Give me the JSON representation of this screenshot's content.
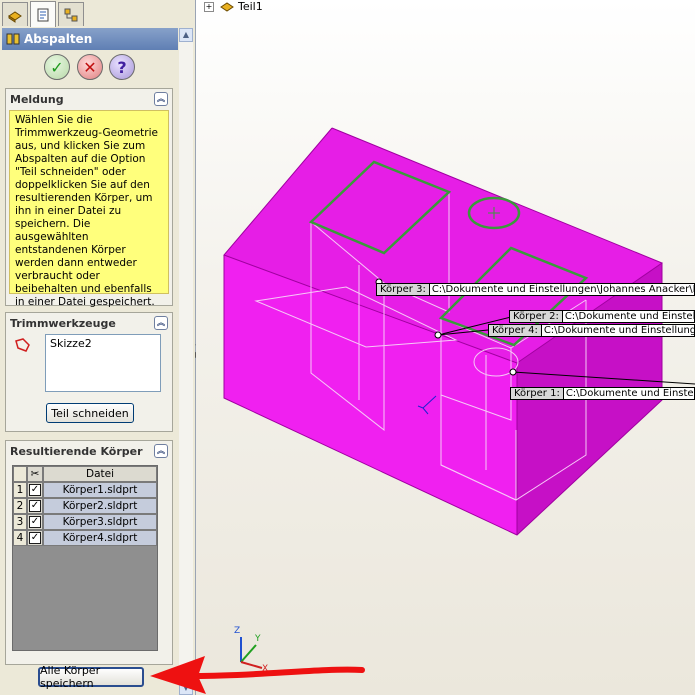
{
  "tree": {
    "root_label": "Teil1",
    "expander": "+"
  },
  "property_manager": {
    "title": "Abspalten",
    "tabs": [
      {
        "icon": "feature-manager-icon"
      },
      {
        "icon": "property-manager-icon"
      },
      {
        "icon": "configuration-manager-icon"
      }
    ],
    "buttons": {
      "ok": "✓",
      "cancel": "✕",
      "help": "?"
    },
    "message": {
      "header": "Meldung",
      "text": "Wählen Sie die Trimmwerkzeug-Geometrie aus, und klicken Sie zum Abspalten auf die Option \"Teil schneiden\" oder doppelklicken Sie auf den resultierenden Körper, um ihn in einer Datei zu speichern. Die ausgewählten entstandenen Körper werden dann entweder verbraucht oder beibehalten und ebenfalls in einer Datei gespeichert."
    },
    "trim_tools": {
      "header": "Trimmwerkzeuge",
      "items": [
        "Skizze2"
      ],
      "cut_button": "Teil schneiden"
    },
    "result_bodies": {
      "header": "Resultierende Körper",
      "column_file": "Datei",
      "rows": [
        {
          "num": "1",
          "file": "Körper1.sldprt"
        },
        {
          "num": "2",
          "file": "Körper2.sldprt"
        },
        {
          "num": "3",
          "file": "Körper3.sldprt"
        },
        {
          "num": "4",
          "file": "Körper4.sldprt"
        }
      ],
      "save_all_button": "Alle Körper speichern"
    }
  },
  "callouts": [
    {
      "label": "Körper  3:",
      "path": "C:\\Dokumente und Einstellungen\\Johannes Anacker\\De"
    },
    {
      "label": "Körper  2:",
      "path": "C:\\Dokumente und Einstellu"
    },
    {
      "label": "Körper  4:",
      "path": "C:\\Dokumente und Einstellunger"
    },
    {
      "label": "Körper  1:",
      "path": "C:\\Dokumente und Einstellu"
    }
  ],
  "triad": {
    "x": "X",
    "y": "Y",
    "z": "Z"
  },
  "colors": {
    "body": "#ff00ff",
    "sketch": "#3a9a3a",
    "annotation_arrow": "#ee1111",
    "message_bg": "#ffff7c",
    "title_bar": "#6f8cbd"
  }
}
